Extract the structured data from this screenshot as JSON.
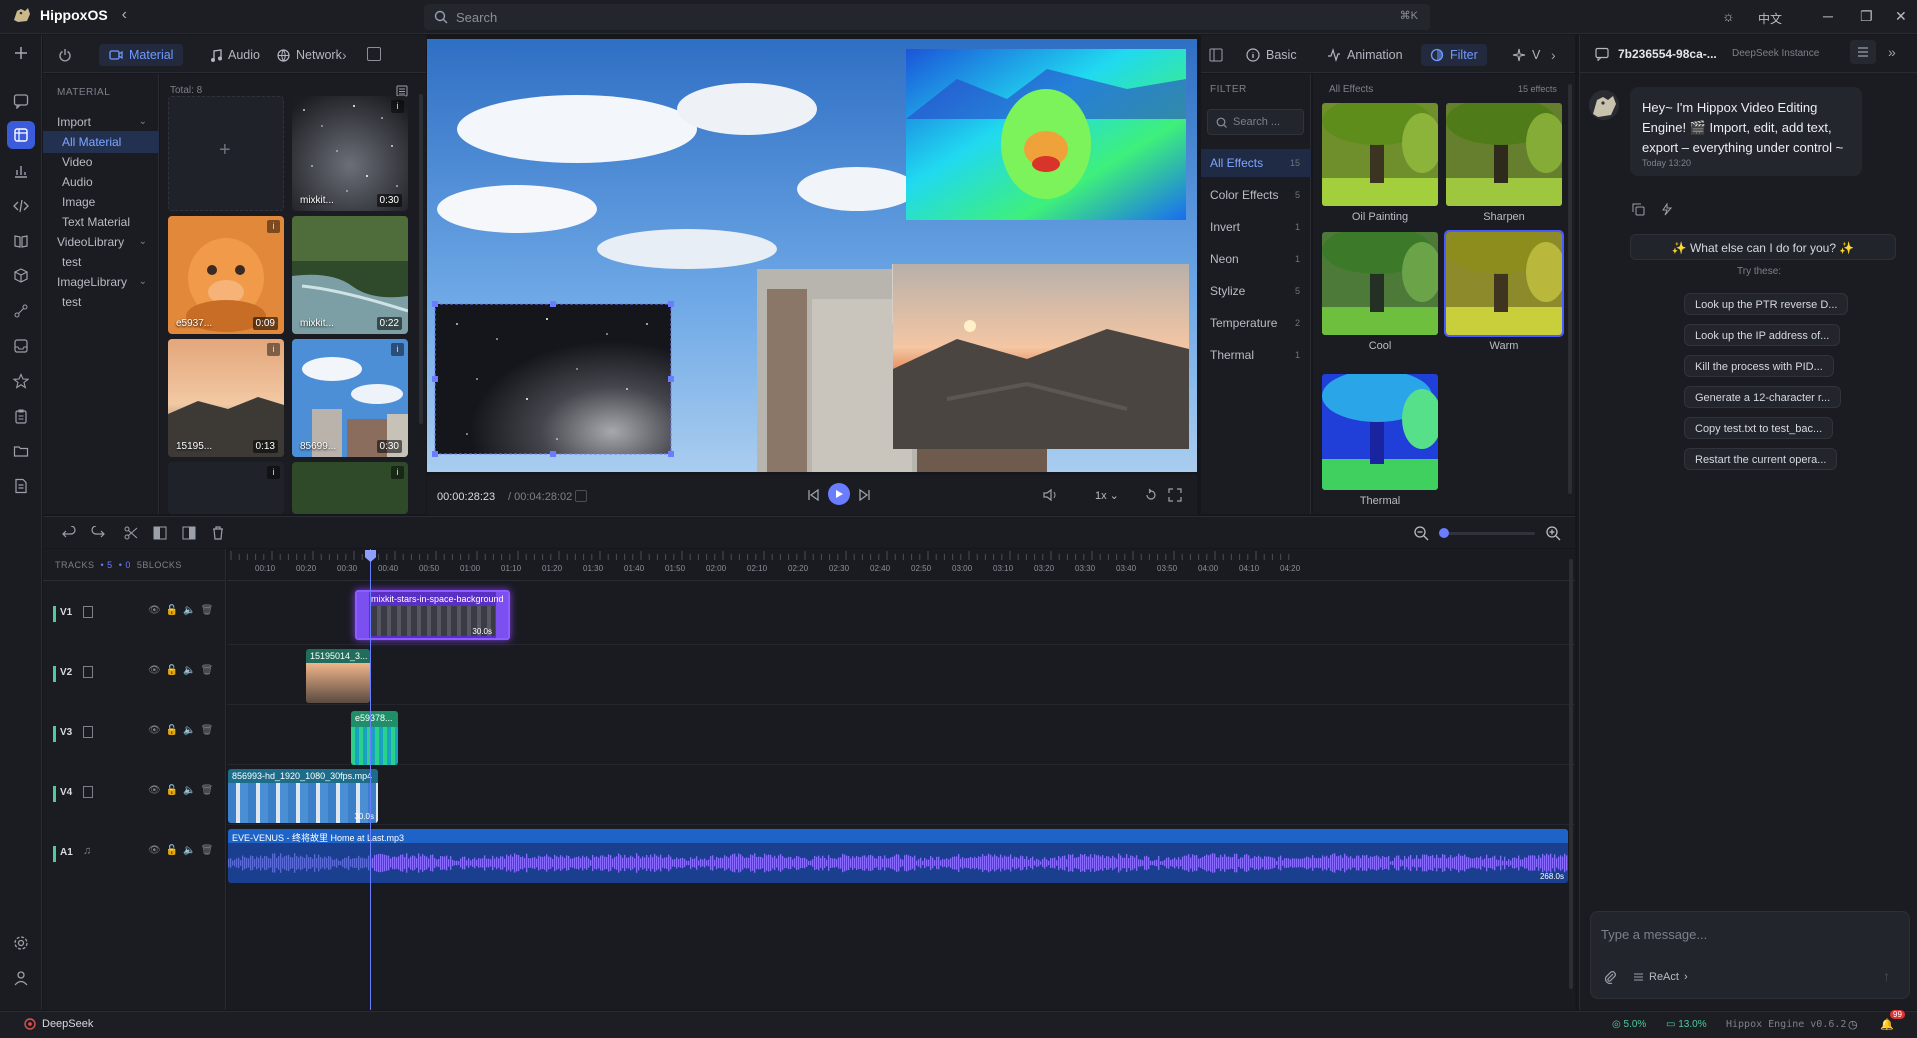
{
  "app": {
    "name": "HippoxOS",
    "language": "中文"
  },
  "search": {
    "placeholder": "Search",
    "shortcut": "⌘K"
  },
  "material_tabs": [
    "Material",
    "Audio",
    "Network"
  ],
  "material": {
    "section_label": "MATERIAL",
    "total": "Total: 8",
    "categories": [
      {
        "label": "Import",
        "expandable": true
      },
      {
        "label": "All Material",
        "active": true
      },
      {
        "label": "Video"
      },
      {
        "label": "Audio"
      },
      {
        "label": "Image"
      },
      {
        "label": "Text Material"
      },
      {
        "label": "VideoLibrary",
        "expandable": true
      },
      {
        "label": "test"
      },
      {
        "label": "ImageLibrary",
        "expandable": true
      },
      {
        "label": "test"
      }
    ],
    "items": [
      {
        "label": "",
        "duration": ""
      },
      {
        "label": "mixkit...",
        "duration": "0:30"
      },
      {
        "label": "e5937...",
        "duration": "0:09"
      },
      {
        "label": "mixkit...",
        "duration": "0:22"
      },
      {
        "label": "15195...",
        "duration": "0:13"
      },
      {
        "label": "85699...",
        "duration": "0:30"
      }
    ]
  },
  "player": {
    "current_time": "00:00:28:23",
    "total_time": "/ 00:04:28:02",
    "speed": "1x"
  },
  "prop_tabs": [
    "Basic",
    "Animation",
    "Filter",
    "V"
  ],
  "filter": {
    "section_label": "FILTER",
    "search_placeholder": "Search ...",
    "grid_label": "All Effects",
    "grid_count": "15 effects",
    "categories": [
      {
        "label": "All Effects",
        "count": "15",
        "active": true
      },
      {
        "label": "Color Effects",
        "count": "5"
      },
      {
        "label": "Invert",
        "count": "1"
      },
      {
        "label": "Neon",
        "count": "1"
      },
      {
        "label": "Stylize",
        "count": "5"
      },
      {
        "label": "Temperature",
        "count": "2"
      },
      {
        "label": "Thermal",
        "count": "1"
      }
    ],
    "effects": [
      "Oil Painting",
      "Sharpen",
      "Cool",
      "Warm",
      "Thermal"
    ]
  },
  "chat": {
    "session_id": "7b236554-98ca-...",
    "instance": "DeepSeek Instance",
    "greeting": "Hey~ I'm Hippox Video Editing Engine! 🎬 Import, edit, add text, export – everything under control ~",
    "time": "Today 13:20",
    "prompt": "✨ What else can I do for you? ✨",
    "try_label": "Try these:",
    "suggestions": [
      "Look up the PTR reverse D...",
      "Look up the IP address of...",
      "Kill the process with PID...",
      "Generate a 12-character r...",
      "Copy test.txt to test_bac...",
      "Restart the current opera..."
    ],
    "input_placeholder": "Type a message...",
    "mode": "ReAct"
  },
  "timeline": {
    "tracks_label": "TRACKS",
    "track_count": "5",
    "blocks": "0",
    "blocks_label": "5BLOCKS",
    "ruler": [
      "00:10",
      "00:20",
      "00:30",
      "00:40",
      "00:50",
      "01:00",
      "01:10",
      "01:20",
      "01:30",
      "01:40",
      "01:50",
      "02:00",
      "02:10",
      "02:20",
      "02:30",
      "02:40",
      "02:50",
      "03:00",
      "03:10",
      "03:20",
      "03:30",
      "03:40",
      "03:50",
      "04:00",
      "04:10",
      "04:20"
    ],
    "tracks": [
      {
        "name": "V1",
        "clip": "mixkit-stars-in-space-background",
        "duration": "30.0s"
      },
      {
        "name": "V2",
        "clip": "15195014_3...",
        "duration": ""
      },
      {
        "name": "V3",
        "clip": "e59378...",
        "duration": ""
      },
      {
        "name": "V4",
        "clip": "856993-hd_1920_1080_30fps.mp4",
        "duration": "30.0s"
      },
      {
        "name": "A1",
        "clip": "EVE-VENUS - 终将故里 Home at Last.mp3",
        "duration": "268.0s"
      }
    ]
  },
  "status": {
    "left": "DeepSeek",
    "cpu": "5.0%",
    "mem": "13.0%",
    "engine": "Hippox Engine v0.6.2",
    "notifications": "99"
  },
  "colors": {
    "accent": "#3b5bdb",
    "accent_text": "#6f9bff",
    "clip_purple": "#7b3fe4",
    "clip_teal": "#2aa889",
    "audio_blue": "#1e64c8"
  }
}
